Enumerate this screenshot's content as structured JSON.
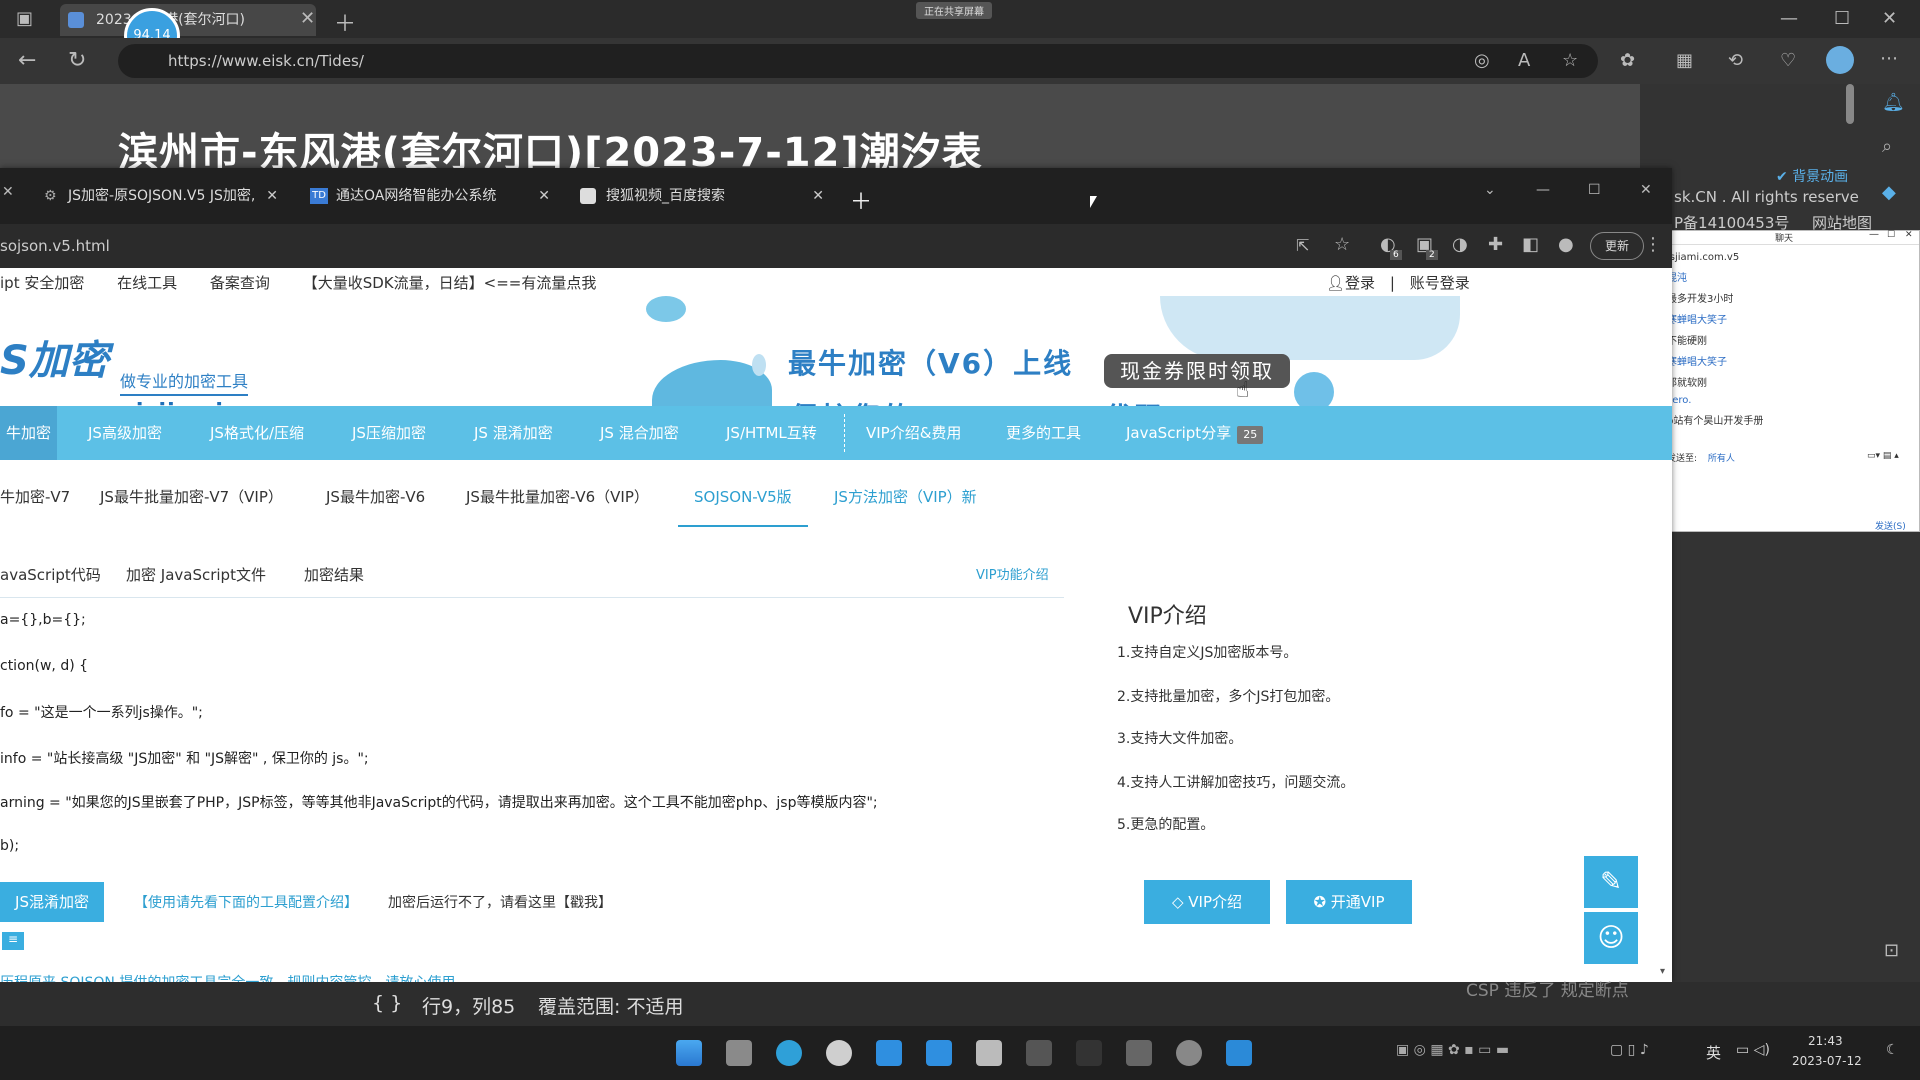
{
  "back_browser": {
    "tab_title": "2023 东风港(套尔河口)",
    "timer": "94.14",
    "url": "https://www.eisk.cn/Tides/",
    "page_heading": "滨州市-东风港(套尔河口)[2023-7-12]潮汐表",
    "top_banner": "正在共享屏幕"
  },
  "right_panel": {
    "checkbox_label": "背景动画",
    "copyright": "sk.CN . All rights reserve",
    "icp": "P备14100453号",
    "icp_link": "网站地图"
  },
  "chat": {
    "title": "聊天",
    "messages": [
      {
        "text": "jsjiami.com.v5",
        "kind": "plain"
      },
      {
        "text": "混沌",
        "kind": "name"
      },
      {
        "text": "最多开发3小时",
        "kind": "plain"
      },
      {
        "text": "寒蝉唱大笑子",
        "kind": "name"
      },
      {
        "text": "不能硬刚",
        "kind": "plain"
      },
      {
        "text": "寒蝉唱大笑子",
        "kind": "name"
      },
      {
        "text": "那就软刚",
        "kind": "plain"
      },
      {
        "text": "zero.",
        "kind": "name"
      },
      {
        "text": "b站有个昊山开发手册",
        "kind": "plain"
      }
    ],
    "send_to_label": "发送至:",
    "send_to_value": "所有人",
    "send_button": "发送(S)"
  },
  "front_browser": {
    "tabs": [
      {
        "title": "JS加密-原SOJSON.V5 JS加密,"
      },
      {
        "title": "通达OA网络智能办公系统"
      },
      {
        "title": "搜狐视频_百度搜索"
      }
    ],
    "url": "sojson.v5.html",
    "update_button": "更新",
    "ext_badge_1": "6",
    "ext_badge_2": "2"
  },
  "page": {
    "topnav": [
      "ipt 安全加密",
      "在线工具",
      "备案查询",
      "【大量收SDK流量，日结】<==有流量点我"
    ],
    "login": "登录",
    "divider": "|",
    "account_login": "账号登录",
    "logo": "S加密",
    "logo_sub": "做专业的加密工具",
    "logo_url": "www.jsjiami.com",
    "banner_line1": "最牛加密（V6）上线",
    "banner_line2": "保护您的JavaScript代码",
    "coupon": "现金券限时领取",
    "mainnav": [
      {
        "label": "牛加密",
        "active": true
      },
      {
        "label": "JS高级加密",
        "active": false
      },
      {
        "label": "JS格式化/压缩",
        "active": false
      },
      {
        "label": "JS压缩加密",
        "active": false
      },
      {
        "label": "JS 混淆加密",
        "active": false
      },
      {
        "label": "JS 混合加密",
        "active": false
      },
      {
        "label": "JS/HTML互转",
        "active": false
      },
      {
        "label": "VIP介绍&费用",
        "active": false
      },
      {
        "label": "更多的工具",
        "active": false
      },
      {
        "label": "JavaScript分享",
        "active": false
      }
    ],
    "share_badge": "25",
    "subnav": [
      {
        "label": "牛加密-V7",
        "active": false
      },
      {
        "label": "JS最牛批量加密-V7（VIP）",
        "active": false
      },
      {
        "label": "JS最牛加密-V6",
        "active": false
      },
      {
        "label": "JS最牛批量加密-V6（VIP）",
        "active": false
      },
      {
        "label": "SOJSON-V5版",
        "active": true
      },
      {
        "label": "JS方法加密（VIP）新",
        "active": false
      }
    ],
    "content_tabs": [
      "avaScript代码",
      "加密 JavaScript文件",
      "加密结果"
    ],
    "vip_func_link": "VIP功能介绍",
    "code_lines": [
      "a={},b={};",
      "ction(w, d) {",
      "fo = \"这是一个一系列js操作。\";",
      "info = \"站长接高级 \"JS加密\" 和 \"JS解密\" , 保卫你的 js。\";",
      "arning = \"如果您的JS里嵌套了PHP，JSP标签，等等其他非JavaScript的代码，请提取出来再加密。这个工具不能加密php、jsp等模版内容\";",
      "b);"
    ],
    "encrypt_button": "JS混淆加密",
    "usage_note": "【使用请先看下面的工具配置介绍】",
    "error_note": "加密后运行不了，请看这里【戳我】",
    "bottom_note": "历程原来 SOJSON 提供的加密工具完全一致，规则内容管控。请放心使用",
    "vip": {
      "title": "VIP介绍",
      "items": [
        "1.支持自定义JS加密版本号。",
        "2.支持批量加密，多个JS打包加密。",
        "3.支持大文件加密。",
        "4.支持人工讲解加密技巧，问题交流。",
        "5.更急的配置。"
      ],
      "btn_intro": "VIP介绍",
      "btn_open": "开通VIP"
    }
  },
  "statusbar": {
    "braces": "{ }",
    "position": "行9，列85",
    "coverage": "覆盖范围: 不适用",
    "right_text": "CSP 违反了 规定断点"
  },
  "taskbar": {
    "lang": "英",
    "time": "21:43",
    "date": "2023-07-12"
  },
  "colors": {
    "accent": "#5cc0e6",
    "brand_blue": "#2d7fc4",
    "button_blue": "#3aaee0"
  }
}
